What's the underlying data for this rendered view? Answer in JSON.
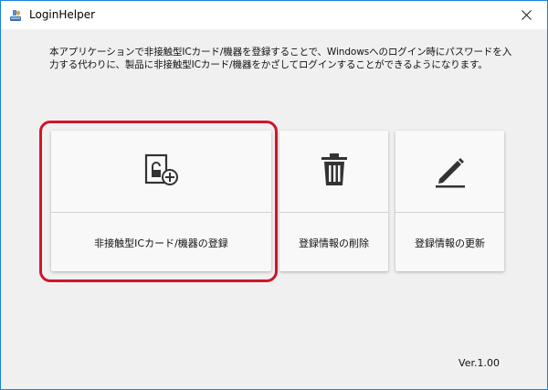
{
  "window": {
    "title": "LoginHelper",
    "app_icon": "loginhelper-app-icon",
    "close_icon": "close-icon",
    "accent_border": "#1883d7"
  },
  "description": "本アプリケーションで非接触型ICカード/機器を登録することで、Windowsへのログイン時にパスワードを入力する代わりに、製品に非接触型ICカード/機器をかざしてログインすることができるようになります。",
  "actions": {
    "register": {
      "label": "非接触型ICカード/機器の登録",
      "icon": "card-lock-add-icon"
    },
    "delete": {
      "label": "登録情報の削除",
      "icon": "trash-icon"
    },
    "update": {
      "label": "登録情報の更新",
      "icon": "pencil-icon"
    }
  },
  "highlight_color": "#d0142a",
  "version": "Ver.1.00"
}
